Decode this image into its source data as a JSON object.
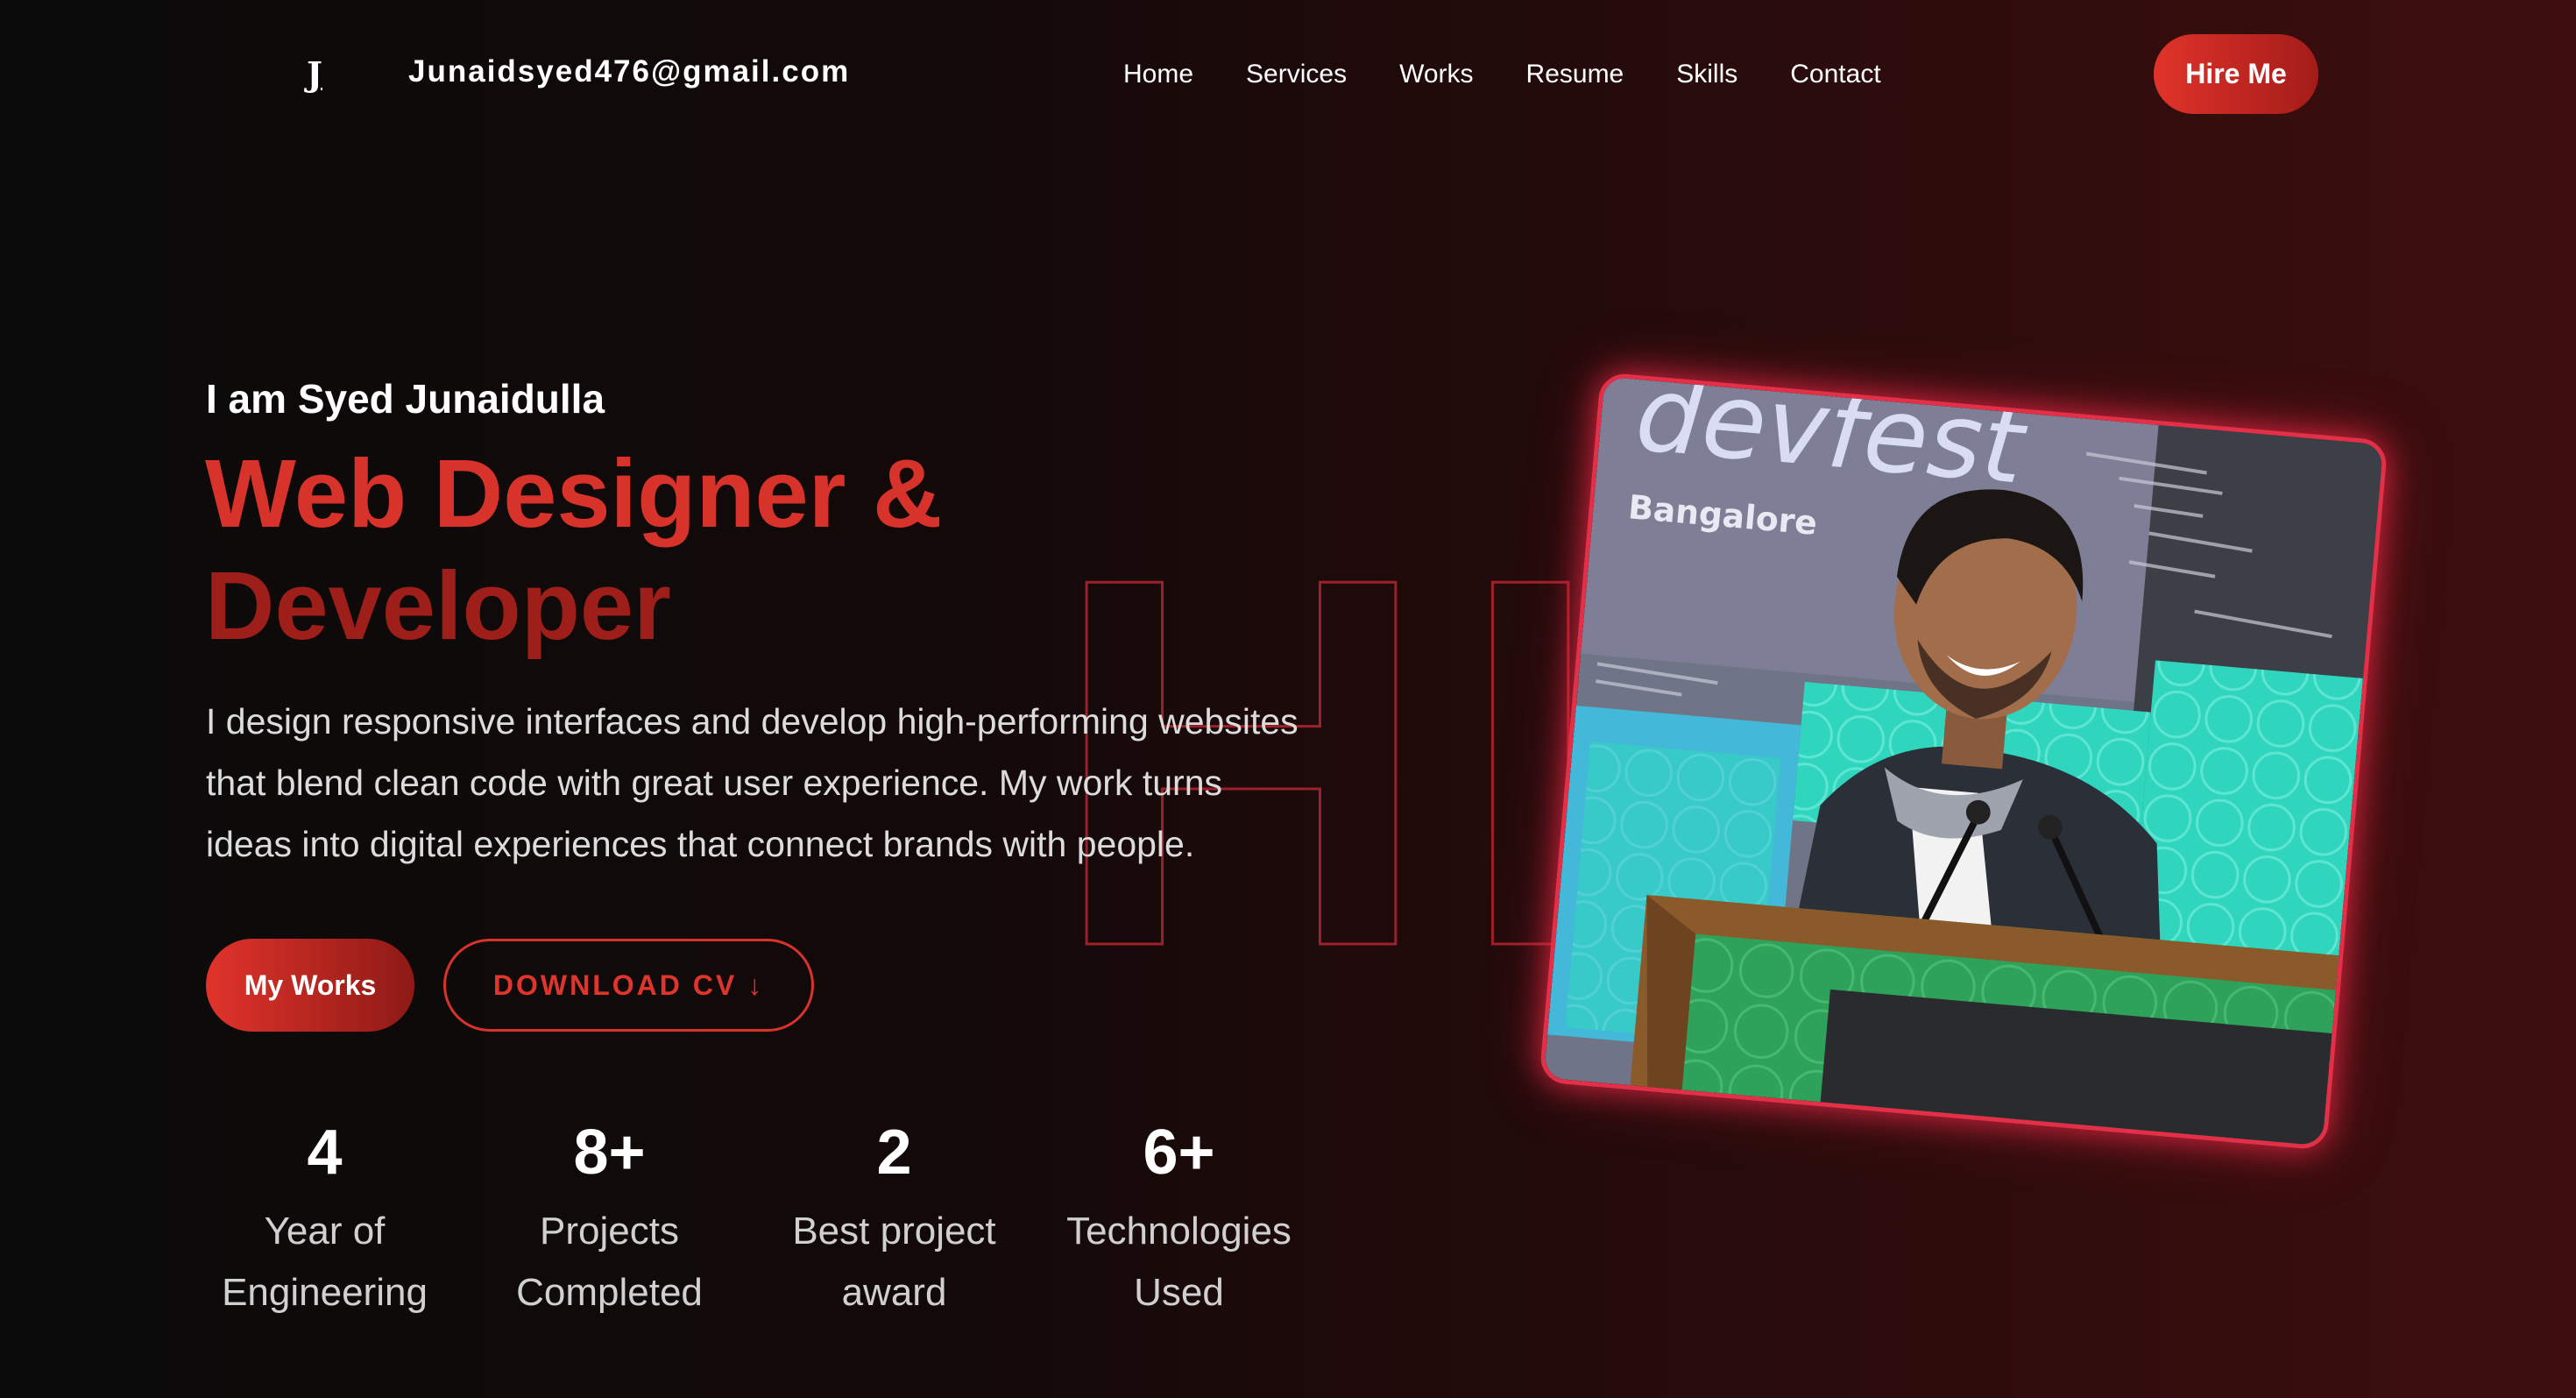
{
  "header": {
    "logo": "J",
    "email": "Junaidsyed476@gmail.com",
    "nav": [
      "Home",
      "Services",
      "Works",
      "Resume",
      "Skills",
      "Contact"
    ],
    "hire_label": "Hire Me"
  },
  "hero": {
    "greeting": "I am Syed Junaidulla",
    "title_line1": "Web Designer &",
    "title_line2": "Developer",
    "description": "I design responsive interfaces and develop high-performing websites that blend clean code with great user experience. My work turns ideas into digital experiences that connect brands with people.",
    "background_text": "HI",
    "works_label": "My Works",
    "cv_label": "DOWNLOAD CV ↓"
  },
  "stats": [
    {
      "value": "4",
      "label": "Year of Engineering"
    },
    {
      "value": "8+",
      "label": "Projects Completed"
    },
    {
      "value": "2",
      "label": "Best project award"
    },
    {
      "value": "6+",
      "label": "Technologies Used"
    }
  ],
  "photo": {
    "banner_text": "devfest",
    "banner_subtext": "Bangalore"
  },
  "colors": {
    "accent": "#d8332b",
    "accent_dark": "#9e1e1a",
    "frame_glow": "#e33048"
  }
}
